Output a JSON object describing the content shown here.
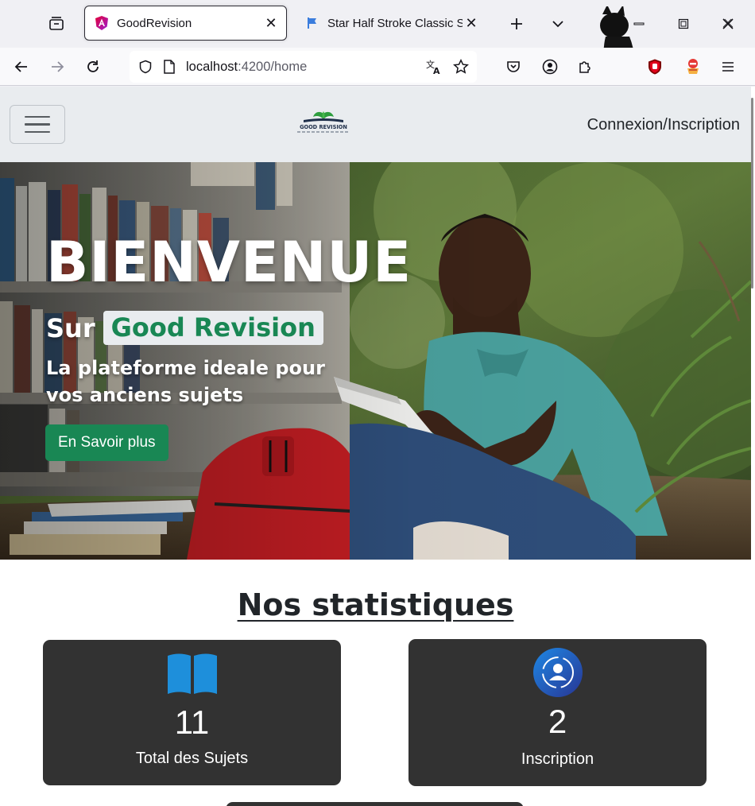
{
  "browser": {
    "tabs": [
      {
        "title": "GoodRevision",
        "active": true,
        "favicon": "angular-icon"
      },
      {
        "title": "Star Half Stroke Classic Solid",
        "active": false,
        "favicon": "flag-icon"
      }
    ],
    "url": {
      "host": "localhost",
      "path": ":4200/home"
    }
  },
  "site": {
    "logo_text": "GOOD REVISION",
    "login_link": "Connexion/Inscription"
  },
  "hero": {
    "title": "BIENVENUE",
    "sur": "Sur",
    "brand": "Good Revision",
    "subtitle": "La plateforme ideale pour vos anciens sujets",
    "cta": "En Savoir plus"
  },
  "stats": {
    "title": "Nos statistiques",
    "cards": [
      {
        "value": "11",
        "label": "Total des Sujets",
        "icon": "book-icon"
      },
      {
        "value": "2",
        "label": "Inscription",
        "icon": "user-cycle-icon"
      }
    ]
  },
  "colors": {
    "brand_green": "#198754",
    "card_bg": "#323232",
    "header_bg": "#e9ecef"
  }
}
